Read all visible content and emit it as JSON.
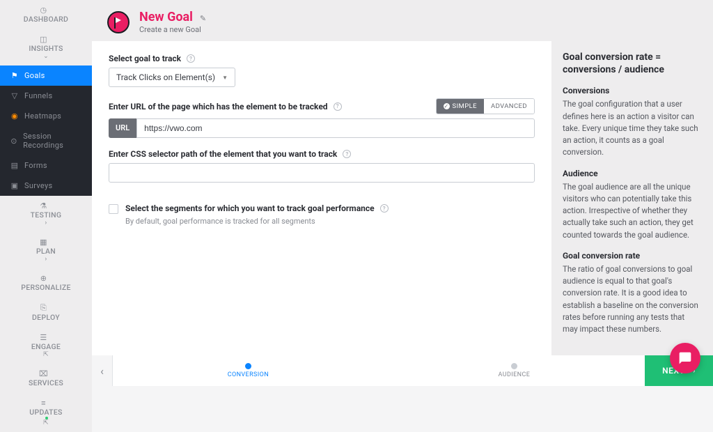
{
  "sidebar": {
    "dashboard": "DASHBOARD",
    "insights": "INSIGHTS",
    "goals": "Goals",
    "funnels": "Funnels",
    "heatmaps": "Heatmaps",
    "session_recordings": "Session Recordings",
    "forms": "Forms",
    "surveys": "Surveys",
    "testing": "TESTING",
    "plan": "PLAN",
    "personalize": "PERSONALIZE",
    "deploy": "DEPLOY",
    "engage": "ENGAGE",
    "services": "SERVICES",
    "updates": "UPDATES"
  },
  "header": {
    "title": "New Goal",
    "subtitle": "Create a new Goal"
  },
  "form": {
    "select_goal_label": "Select goal to track",
    "select_goal_value": "Track Clicks on Element(s)",
    "url_label": "Enter URL of the page which has the element to be tracked",
    "url_prefix": "URL",
    "url_value": "https://vwo.com",
    "simple": "SIMPLE",
    "advanced": "ADVANCED",
    "css_label": "Enter CSS selector path of the element that you want to track",
    "seg_title": "Select the segments for which you want to track goal performance",
    "seg_sub": "By default, goal performance is tracked for all segments"
  },
  "footer": {
    "step1": "CONVERSION",
    "step2": "AUDIENCE",
    "next": "NEXT"
  },
  "info": {
    "title": "Goal conversion rate = conversions / audience",
    "h1": "Conversions",
    "p1": "The goal configuration that a user defines here is an action a visitor can take. Every unique time they take such an action, it counts as a goal conversion.",
    "h2": "Audience",
    "p2": "The goal audience are all the unique visitors who can potentially take this action. Irrespective of whether they actually take such an action, they get counted towards the goal audience.",
    "h3": "Goal conversion rate",
    "p3": "The ratio of goal conversions to goal audience is equal to that goal's conversion rate. It is a good idea to establish a baseline on the conversion rates before running any tests that may impact these numbers."
  }
}
